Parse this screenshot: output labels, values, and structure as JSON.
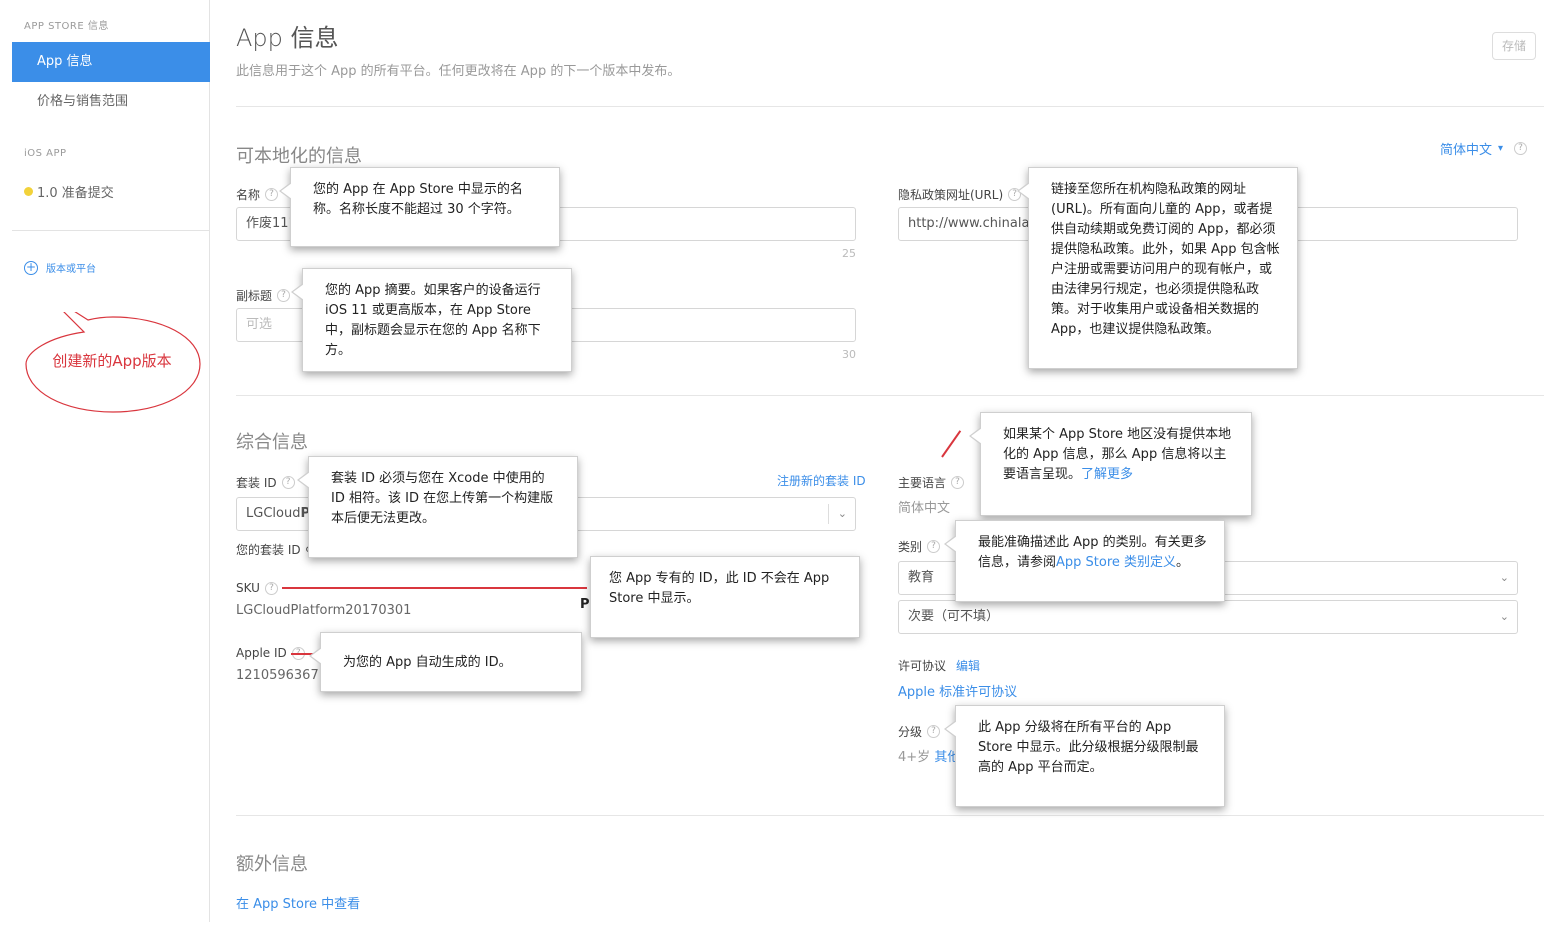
{
  "sidebar": {
    "section1_heading": "APP STORE 信息",
    "items": [
      {
        "label": "App 信息",
        "active": true
      },
      {
        "label": "价格与销售范围",
        "active": false
      }
    ],
    "section2_heading": "iOS APP",
    "version_item": {
      "label": "1.0 准备提交",
      "status_color": "#f2d23a"
    },
    "add_version_label": "版本或平台",
    "annotation_text": "创建新的App版本"
  },
  "header": {
    "title": "App 信息",
    "subtitle": "此信息用于这个 App 的所有平台。任何更改将在 App 的下一个版本中发布。",
    "save_label": "存储"
  },
  "localizable": {
    "title": "可本地化的信息",
    "language": "简体中文",
    "name_label": "名称",
    "name_value": "作废111",
    "name_counter": "25",
    "subtitle_label": "副标题",
    "subtitle_placeholder": "可选",
    "subtitle_counter": "30",
    "privacy_label": "隐私政策网址(URL)",
    "privacy_value": "http://www.chinalan",
    "privacy_value_tail": "n"
  },
  "general": {
    "title": "综合信息",
    "bundle_label": "套装 ID",
    "register_bundle_link": "注册新的套装 ID",
    "bundle_value": "LGCloud",
    "bundle_value_tail": "P",
    "your_bundle_label": "您的套装 ID",
    "your_bundle_tail": "c",
    "sku_label": "SKU",
    "sku_value": "LGCloudPlatform20170301",
    "sku_tail": "P",
    "appleid_label": "Apple ID",
    "appleid_value": "1210596367",
    "primary_lang_label": "主要语言",
    "primary_lang_value": "简体中文",
    "category_label": "类别",
    "category_primary": "教育",
    "category_secondary": "次要（可不填）",
    "license_label": "许可协议",
    "license_edit": "编辑",
    "license_link": "Apple 标准许可协议",
    "rating_label": "分级",
    "rating_value": "4+岁",
    "rating_link": "其他"
  },
  "additional": {
    "title": "额外信息",
    "view_link": "在 App Store 中查看"
  },
  "tooltips": {
    "name": "您的 App 在 App Store 中显示的名称。名称长度不能超过 30 个字符。",
    "subtitle": "您的 App 摘要。如果客户的设备运行 iOS 11 或更高版本，在 App Store 中，副标题会显示在您的 App 名称下方。",
    "privacy": "链接至您所在机构隐私政策的网址(URL)。所有面向儿童的 App，或者提供自动续期或免费订阅的 App，都必须提供隐私政策。此外，如果 App 包含帐户注册或需要访问用户的现有帐户，或由法律另行规定，也必须提供隐私政策。对于收集用户或设备相关数据的 App，也建议提供隐私政策。",
    "bundle": "套装 ID 必须与您在 Xcode 中使用的 ID 相符。该 ID 在您上传第一个构建版本后便无法更改。",
    "sku": "您 App 专有的 ID，此 ID 不会在 App Store 中显示。",
    "appleid": "为您的 App 自动生成的 ID。",
    "primary_lang": "如果某个 App Store 地区没有提供本地化的 App 信息，那么 App 信息将以主要语言呈现。",
    "primary_lang_link": "了解更多",
    "category": "最能准确描述此 App 的类别。有关更多信息，请参阅",
    "category_link": "App Store 类别定义",
    "category_end": "。",
    "rating": "此 App 分级将在所有平台的 App Store 中显示。此分级根据分级限制最高的 App 平台而定。"
  },
  "colors": {
    "accent": "#3b8ee8",
    "annotation_red": "#d9363e"
  }
}
